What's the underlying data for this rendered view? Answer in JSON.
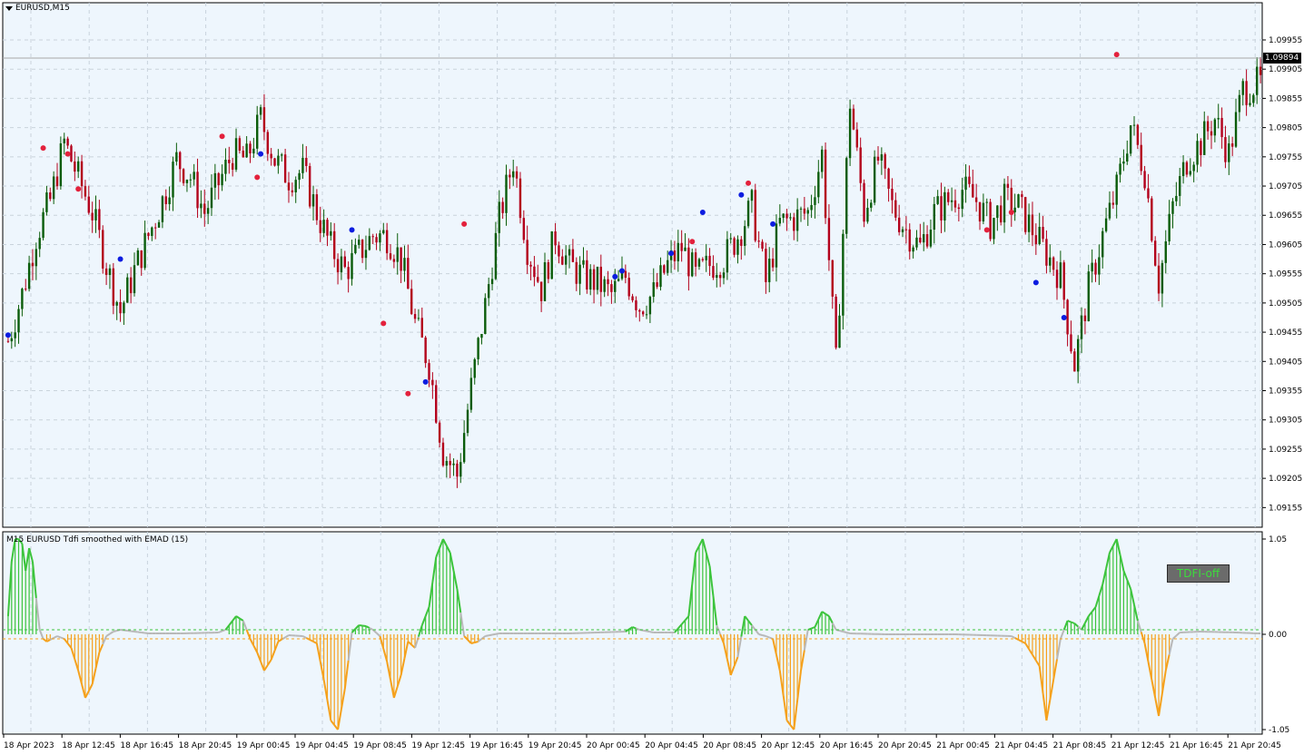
{
  "window": {
    "symbol_title": "EURUSD,M15"
  },
  "indicator": {
    "title": "M15 EURUSD Tdfi smoothed with EMAD (15)",
    "button_label": "TDFI-off"
  },
  "current_price": "1.09894",
  "colors": {
    "background": "#eef6fd",
    "grid": "#c9d3dc",
    "bull_candle": "#0a5c0a",
    "bear_candle": "#b3001b",
    "dot_red": "#e3213c",
    "dot_blue": "#0c1ce0",
    "hist_green": "#3cc43c",
    "hist_orange": "#f5a11c",
    "neutral_line": "#b8b8b8",
    "level_up": "#3cc43c",
    "level_down": "#f5a11c"
  },
  "chart_data": [
    {
      "type": "candlestick",
      "title": "EURUSD,M15",
      "ylim": [
        1.0914,
        1.1
      ],
      "y_ticks": [
        "1.09955",
        "1.09905",
        "1.09855",
        "1.09805",
        "1.09755",
        "1.09705",
        "1.09655",
        "1.09605",
        "1.09555",
        "1.09505",
        "1.09455",
        "1.09405",
        "1.09355",
        "1.09305",
        "1.09255",
        "1.09205",
        "1.09155"
      ],
      "x_ticks": [
        "18 Apr 2023",
        "18 Apr 12:45",
        "18 Apr 16:45",
        "18 Apr 20:45",
        "19 Apr 00:45",
        "19 Apr 04:45",
        "19 Apr 08:45",
        "19 Apr 12:45",
        "19 Apr 16:45",
        "19 Apr 20:45",
        "20 Apr 00:45",
        "20 Apr 04:45",
        "20 Apr 08:45",
        "20 Apr 12:45",
        "20 Apr 16:45",
        "20 Apr 20:45",
        "21 Apr 00:45",
        "21 Apr 04:45",
        "21 Apr 08:45",
        "21 Apr 12:45",
        "21 Apr 16:45",
        "21 Apr 20:45"
      ],
      "close_path": [
        [
          0,
          1.0944
        ],
        [
          4,
          1.0952
        ],
        [
          8,
          1.0962
        ],
        [
          12,
          1.0968
        ],
        [
          16,
          1.0978
        ],
        [
          20,
          1.0972
        ],
        [
          24,
          1.0966
        ],
        [
          28,
          1.0957
        ],
        [
          32,
          1.0949
        ],
        [
          36,
          1.0956
        ],
        [
          40,
          1.0962
        ],
        [
          44,
          1.0968
        ],
        [
          48,
          1.0975
        ],
        [
          52,
          1.0972
        ],
        [
          56,
          1.0966
        ],
        [
          60,
          1.0971
        ],
        [
          64,
          1.0976
        ],
        [
          68,
          1.0975
        ],
        [
          72,
          1.0982
        ],
        [
          76,
          1.0975
        ],
        [
          80,
          1.0972
        ],
        [
          84,
          1.0973
        ],
        [
          88,
          1.0966
        ],
        [
          92,
          1.096
        ],
        [
          96,
          1.0956
        ],
        [
          100,
          1.0959
        ],
        [
          104,
          1.0962
        ],
        [
          108,
          1.0962
        ],
        [
          112,
          1.0958
        ],
        [
          116,
          1.0947
        ],
        [
          120,
          1.094
        ],
        [
          124,
          1.0925
        ],
        [
          128,
          1.0921
        ],
        [
          132,
          1.0936
        ],
        [
          136,
          1.095
        ],
        [
          140,
          1.0965
        ],
        [
          144,
          1.0975
        ],
        [
          148,
          1.096
        ],
        [
          152,
          1.0953
        ],
        [
          156,
          1.0962
        ],
        [
          160,
          1.0957
        ],
        [
          164,
          1.0955
        ],
        [
          168,
          1.0954
        ],
        [
          172,
          1.0952
        ],
        [
          176,
          1.0955
        ],
        [
          180,
          1.095
        ],
        [
          184,
          1.0952
        ],
        [
          188,
          1.0957
        ],
        [
          192,
          1.096
        ],
        [
          196,
          1.0955
        ],
        [
          200,
          1.0957
        ],
        [
          204,
          1.0958
        ],
        [
          208,
          1.0962
        ],
        [
          212,
          1.0967
        ],
        [
          216,
          1.0954
        ],
        [
          220,
          1.0964
        ],
        [
          224,
          1.0965
        ],
        [
          228,
          1.0966
        ],
        [
          232,
          1.0976
        ],
        [
          236,
          1.094
        ],
        [
          240,
          1.0985
        ],
        [
          244,
          1.0966
        ],
        [
          248,
          1.0975
        ],
        [
          252,
          1.0967
        ],
        [
          256,
          1.0963
        ],
        [
          260,
          1.096
        ],
        [
          264,
          1.0966
        ],
        [
          268,
          1.0968
        ],
        [
          272,
          1.097
        ],
        [
          276,
          1.0968
        ],
        [
          280,
          1.0964
        ],
        [
          284,
          1.0968
        ],
        [
          288,
          1.0967
        ],
        [
          292,
          1.0963
        ],
        [
          296,
          1.0959
        ],
        [
          300,
          1.0955
        ],
        [
          304,
          1.094
        ],
        [
          308,
          1.0953
        ],
        [
          312,
          1.0962
        ],
        [
          316,
          1.097
        ],
        [
          320,
          1.0981
        ],
        [
          324,
          1.0973
        ],
        [
          328,
          1.0954
        ],
        [
          332,
          1.0967
        ],
        [
          336,
          1.0975
        ],
        [
          340,
          1.0978
        ],
        [
          344,
          1.0982
        ],
        [
          348,
          1.0976
        ],
        [
          352,
          1.0987
        ],
        [
          356,
          1.0988
        ]
      ],
      "red_dots": [
        [
          10,
          1.0977
        ],
        [
          17,
          1.0976
        ],
        [
          20,
          1.097
        ],
        [
          61,
          1.0979
        ],
        [
          71,
          1.0972
        ],
        [
          107,
          1.0947
        ],
        [
          114,
          1.0935
        ],
        [
          130,
          1.0964
        ],
        [
          195,
          1.0961
        ],
        [
          211,
          1.0971
        ],
        [
          279,
          1.0963
        ],
        [
          286,
          1.0966
        ],
        [
          316,
          1.0993
        ]
      ],
      "blue_dots": [
        [
          0,
          1.0945
        ],
        [
          32,
          1.0958
        ],
        [
          72,
          1.0976
        ],
        [
          98,
          1.0963
        ],
        [
          119,
          1.0937
        ],
        [
          173,
          1.0955
        ],
        [
          175,
          1.0956
        ],
        [
          189,
          1.0959
        ],
        [
          198,
          1.0966
        ],
        [
          209,
          1.0969
        ],
        [
          218,
          1.0964
        ],
        [
          293,
          1.0954
        ],
        [
          301,
          1.0948
        ]
      ]
    },
    {
      "type": "histogram",
      "title": "M15 EURUSD Tdfi smoothed with EMAD (15)",
      "ylim": [
        -1.05,
        1.05
      ],
      "y_ticks": [
        "1.05",
        "0.00",
        "-1.05"
      ],
      "levels": [
        0.05,
        -0.05
      ],
      "points": [
        [
          0,
          0.2
        ],
        [
          1,
          0.8
        ],
        [
          2,
          1.05
        ],
        [
          3,
          1.05
        ],
        [
          4,
          1.0
        ],
        [
          5,
          0.7
        ],
        [
          6,
          0.95
        ],
        [
          7,
          0.8
        ],
        [
          8,
          0.4
        ],
        [
          9,
          0.05
        ],
        [
          10,
          -0.05
        ],
        [
          11,
          -0.08
        ],
        [
          12,
          -0.06
        ],
        [
          13,
          -0.04
        ],
        [
          14,
          -0.02
        ],
        [
          16,
          -0.05
        ],
        [
          18,
          -0.15
        ],
        [
          20,
          -0.4
        ],
        [
          22,
          -0.7
        ],
        [
          24,
          -0.55
        ],
        [
          26,
          -0.2
        ],
        [
          28,
          -0.02
        ],
        [
          30,
          0.03
        ],
        [
          32,
          0.05
        ],
        [
          36,
          0.03
        ],
        [
          40,
          0.01
        ],
        [
          50,
          0.01
        ],
        [
          60,
          0.02
        ],
        [
          62,
          0.05
        ],
        [
          65,
          0.2
        ],
        [
          67,
          0.15
        ],
        [
          69,
          -0.05
        ],
        [
          71,
          -0.2
        ],
        [
          73,
          -0.4
        ],
        [
          75,
          -0.28
        ],
        [
          77,
          -0.08
        ],
        [
          80,
          -0.01
        ],
        [
          84,
          -0.02
        ],
        [
          88,
          -0.1
        ],
        [
          90,
          -0.5
        ],
        [
          92,
          -0.95
        ],
        [
          94,
          -1.05
        ],
        [
          96,
          -0.6
        ],
        [
          98,
          0.02
        ],
        [
          100,
          0.1
        ],
        [
          102,
          0.09
        ],
        [
          104,
          0.05
        ],
        [
          106,
          -0.02
        ],
        [
          108,
          -0.3
        ],
        [
          110,
          -0.7
        ],
        [
          112,
          -0.45
        ],
        [
          114,
          -0.08
        ],
        [
          116,
          -0.15
        ],
        [
          118,
          0.1
        ],
        [
          120,
          0.3
        ],
        [
          122,
          0.85
        ],
        [
          124,
          1.05
        ],
        [
          126,
          0.9
        ],
        [
          128,
          0.5
        ],
        [
          130,
          -0.02
        ],
        [
          132,
          -0.1
        ],
        [
          134,
          -0.08
        ],
        [
          136,
          -0.02
        ],
        [
          140,
          0.01
        ],
        [
          160,
          0.01
        ],
        [
          176,
          0.03
        ],
        [
          178,
          0.08
        ],
        [
          180,
          0.05
        ],
        [
          184,
          0.02
        ],
        [
          190,
          0.02
        ],
        [
          194,
          0.2
        ],
        [
          196,
          0.9
        ],
        [
          198,
          1.05
        ],
        [
          200,
          0.75
        ],
        [
          202,
          0.1
        ],
        [
          204,
          -0.1
        ],
        [
          206,
          -0.45
        ],
        [
          208,
          -0.25
        ],
        [
          210,
          0.2
        ],
        [
          212,
          0.1
        ],
        [
          214,
          0.0
        ],
        [
          216,
          -0.02
        ],
        [
          218,
          -0.05
        ],
        [
          220,
          -0.4
        ],
        [
          222,
          -0.95
        ],
        [
          224,
          -1.05
        ],
        [
          226,
          -0.4
        ],
        [
          228,
          0.05
        ],
        [
          230,
          0.08
        ],
        [
          232,
          0.25
        ],
        [
          234,
          0.2
        ],
        [
          236,
          0.05
        ],
        [
          240,
          0.01
        ],
        [
          250,
          0.0
        ],
        [
          270,
          0.0
        ],
        [
          286,
          -0.02
        ],
        [
          288,
          -0.06
        ],
        [
          290,
          -0.1
        ],
        [
          294,
          -0.35
        ],
        [
          296,
          -0.95
        ],
        [
          298,
          -0.5
        ],
        [
          300,
          -0.05
        ],
        [
          302,
          0.15
        ],
        [
          304,
          0.12
        ],
        [
          306,
          0.05
        ],
        [
          308,
          0.2
        ],
        [
          310,
          0.3
        ],
        [
          312,
          0.55
        ],
        [
          314,
          0.9
        ],
        [
          316,
          1.05
        ],
        [
          318,
          0.7
        ],
        [
          320,
          0.5
        ],
        [
          322,
          0.15
        ],
        [
          324,
          -0.1
        ],
        [
          326,
          -0.5
        ],
        [
          328,
          -0.9
        ],
        [
          330,
          -0.4
        ],
        [
          332,
          -0.05
        ],
        [
          334,
          0.02
        ],
        [
          340,
          0.03
        ],
        [
          350,
          0.02
        ],
        [
          356,
          0.01
        ]
      ]
    }
  ]
}
